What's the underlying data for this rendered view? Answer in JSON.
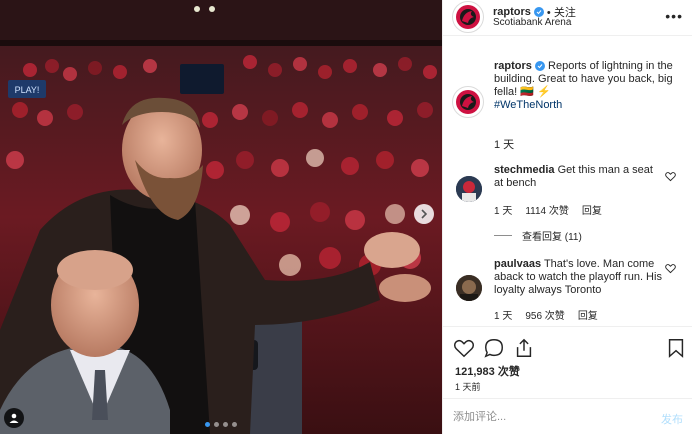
{
  "post": {
    "username": "raptors",
    "follow_label": "• 关注",
    "location": "Scotiabank Arena",
    "caption_username": "raptors",
    "caption_text": "Reports of lightning in the building. Great to have you back, big fella! 🇱🇹 ⚡",
    "hashtag": "#WeTheNorth",
    "caption_time": "1 天",
    "likes": "121,983 次赞",
    "posted_time": "1 天前",
    "comment_placeholder": "添加评论...",
    "post_label": "发布",
    "carousel_index": 1,
    "carousel_count": 4
  },
  "photo": {
    "scoreboard_text": "PLAY!"
  },
  "comments": [
    {
      "username": "stechmedia",
      "text": "Get this man a seat at bench",
      "time": "1 天",
      "likes": "1114 次赞",
      "reply_label": "回复",
      "view_replies": "查看回复 (11)"
    },
    {
      "username": "paulvaas",
      "text": "That's love. Man come aback to watch the playoff run. His loyalty always Toronto",
      "time": "1 天",
      "likes": "956 次赞",
      "reply_label": "回复"
    }
  ],
  "icons": {
    "verified": "verified-badge-icon",
    "more": "more-options-icon",
    "like": "heart-icon",
    "comment": "comment-bubble-icon",
    "share": "share-icon",
    "save": "bookmark-icon",
    "next": "chevron-right-icon",
    "tag": "user-tag-icon"
  },
  "colors": {
    "brand_red": "#ce1141",
    "link_blue": "#003569",
    "verified_blue": "#3897f0",
    "post_button_disabled": "#b2dffc"
  }
}
